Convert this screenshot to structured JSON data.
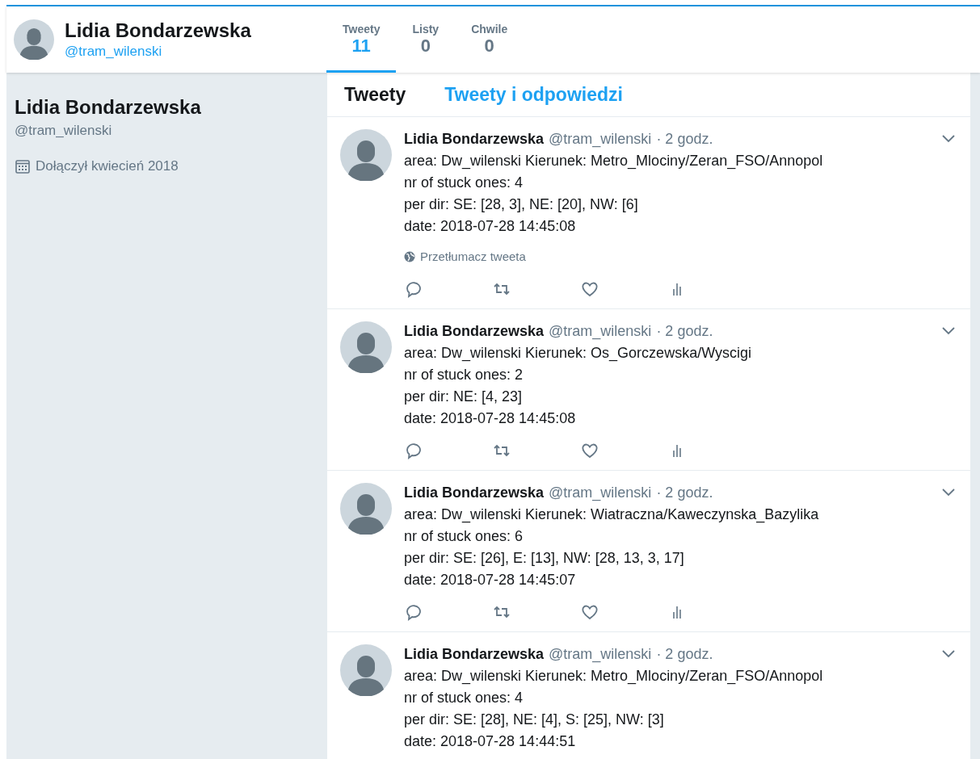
{
  "header": {
    "name": "Lidia Bondarzewska",
    "handle": "@tram_wilenski",
    "stats": [
      {
        "label": "Tweety",
        "count": "11",
        "selected": true
      },
      {
        "label": "Listy",
        "count": "0",
        "selected": false
      },
      {
        "label": "Chwile",
        "count": "0",
        "selected": false
      }
    ]
  },
  "sidebar": {
    "name": "Lidia Bondarzewska",
    "handle": "@tram_wilenski",
    "joined": "Dołączył kwiecień 2018"
  },
  "timeline_tabs": [
    {
      "label": "Tweety",
      "selected": true
    },
    {
      "label": "Tweety i odpowiedzi",
      "selected": false
    }
  ],
  "tweets": [
    {
      "name": "Lidia Bondarzewska",
      "handle": "@tram_wilenski",
      "time": "· 2 godz.",
      "lines": [
        "area: Dw_wilenski Kierunek: Metro_Mlociny/Zeran_FSO/Annopol",
        "nr of stuck ones: 4",
        "per dir: SE: [28, 3], NE: [20], NW: [6]",
        "date: 2018-07-28 14:45:08"
      ],
      "translate": "Przetłumacz tweeta",
      "actions_visible": true
    },
    {
      "name": "Lidia Bondarzewska",
      "handle": "@tram_wilenski",
      "time": "· 2 godz.",
      "lines": [
        "area: Dw_wilenski Kierunek: Os_Gorczewska/Wyscigi",
        "nr of stuck ones: 2",
        "per dir: NE: [4, 23]",
        "date: 2018-07-28 14:45:08"
      ],
      "actions_visible": true
    },
    {
      "name": "Lidia Bondarzewska",
      "handle": "@tram_wilenski",
      "time": "· 2 godz.",
      "lines": [
        "area: Dw_wilenski Kierunek: Wiatraczna/Kaweczynska_Bazylika",
        "nr of stuck ones: 6",
        "per dir: SE: [26], E: [13], NW: [28, 13, 3, 17]",
        "date: 2018-07-28 14:45:07"
      ],
      "actions_visible": true
    },
    {
      "name": "Lidia Bondarzewska",
      "handle": "@tram_wilenski",
      "time": "· 2 godz.",
      "lines": [
        "area: Dw_wilenski Kierunek: Metro_Mlociny/Zeran_FSO/Annopol",
        "nr of stuck ones: 4",
        "per dir: SE: [28], NE: [4], S: [25], NW: [3]",
        "date: 2018-07-28 14:44:51"
      ],
      "actions_visible": false
    }
  ]
}
